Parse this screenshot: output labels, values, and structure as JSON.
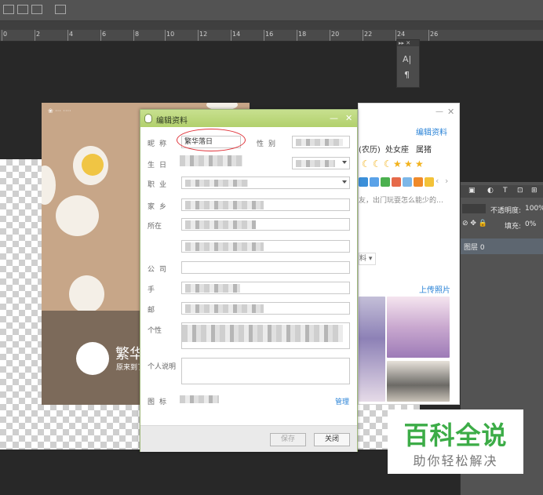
{
  "ruler": {
    "labels": [
      "0",
      "2",
      "4",
      "6",
      "8",
      "10",
      "12",
      "14",
      "16",
      "18",
      "20",
      "22",
      "24",
      "26"
    ]
  },
  "char_panel": {
    "icon_a": "A|",
    "icon_para": "¶"
  },
  "layers_panel": {
    "opacity_label": "不透明度:",
    "opacity_value": "100%",
    "fill_label": "填充:",
    "fill_value": "0%",
    "layer_name": "图层 0"
  },
  "card": {
    "name": "繁华",
    "desc": "原来到了"
  },
  "qq_panel": {
    "edit_link": "编辑资料",
    "lunar": "(农历)",
    "zodiac": "处女座",
    "chinese_zodiac": "属猪",
    "signature": "友，出门玩耍怎么能少的…",
    "dropdown": "料",
    "upload_link": "上传照片"
  },
  "dialog": {
    "title": "编辑资料",
    "labels": {
      "nickname": "昵称",
      "gender": "性别",
      "birthday": "生日",
      "job": "职业",
      "hometown": "家乡",
      "location": "所在",
      "company": "公司",
      "mobile": "手",
      "email": "邮",
      "personal": "个性",
      "description": "个人说明",
      "icons": "图标"
    },
    "nickname_value": "繁华落日",
    "manage_link": "管理",
    "save_button": "保存",
    "close_button": "关闭"
  },
  "watermark": {
    "title": "百科全说",
    "subtitle": "助你轻松解决"
  },
  "colors": {
    "accent_green": "#3cac47",
    "link_blue": "#2a83d7",
    "highlight_red": "#e0333a"
  }
}
